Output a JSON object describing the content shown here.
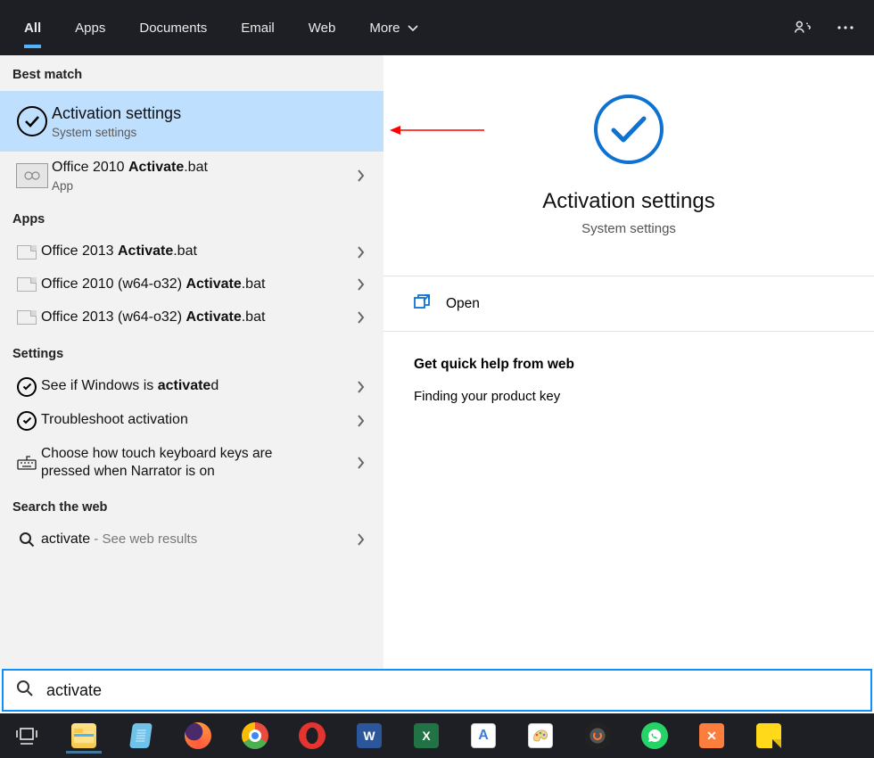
{
  "tabs": {
    "all": "All",
    "apps": "Apps",
    "documents": "Documents",
    "email": "Email",
    "web": "Web",
    "more": "More"
  },
  "sections": {
    "best_match": "Best match",
    "apps": "Apps",
    "settings": "Settings",
    "web": "Search the web"
  },
  "best": {
    "title": "Activation settings",
    "sub": "System settings"
  },
  "best2": {
    "pre": "Office 2010 ",
    "bold": "Activate",
    "post": ".bat",
    "sub": "App"
  },
  "apps_list": [
    {
      "pre": "Office 2013 ",
      "bold": "Activate",
      "post": ".bat"
    },
    {
      "pre": "Office 2010 (w64-o32) ",
      "bold": "Activate",
      "post": ".bat"
    },
    {
      "pre": "Office 2013 (w64-o32) ",
      "bold": "Activate",
      "post": ".bat"
    }
  ],
  "settings_list": [
    {
      "pre": "See if Windows is ",
      "bold": "activate",
      "post": "d",
      "icon": "check"
    },
    {
      "pre": "Troubleshoot activation",
      "bold": "",
      "post": "",
      "icon": "check"
    },
    {
      "pre": "Choose how touch keyboard keys are pressed when Narrator is on",
      "bold": "",
      "post": "",
      "icon": "keyboard"
    }
  ],
  "web_result": {
    "term": "activate",
    "suffix": " - See web results"
  },
  "right": {
    "title": "Activation settings",
    "sub": "System settings",
    "open": "Open",
    "help_header": "Get quick help from web",
    "help_items": [
      "Finding your product key"
    ]
  },
  "search": {
    "value": "activate"
  },
  "taskbar": {
    "items": [
      "task-view",
      "file-explorer",
      "notepad",
      "firefox",
      "chrome",
      "opera",
      "word",
      "excel",
      "wordpad",
      "paint",
      "app-generic",
      "whatsapp",
      "xampp",
      "sticky-notes"
    ]
  }
}
